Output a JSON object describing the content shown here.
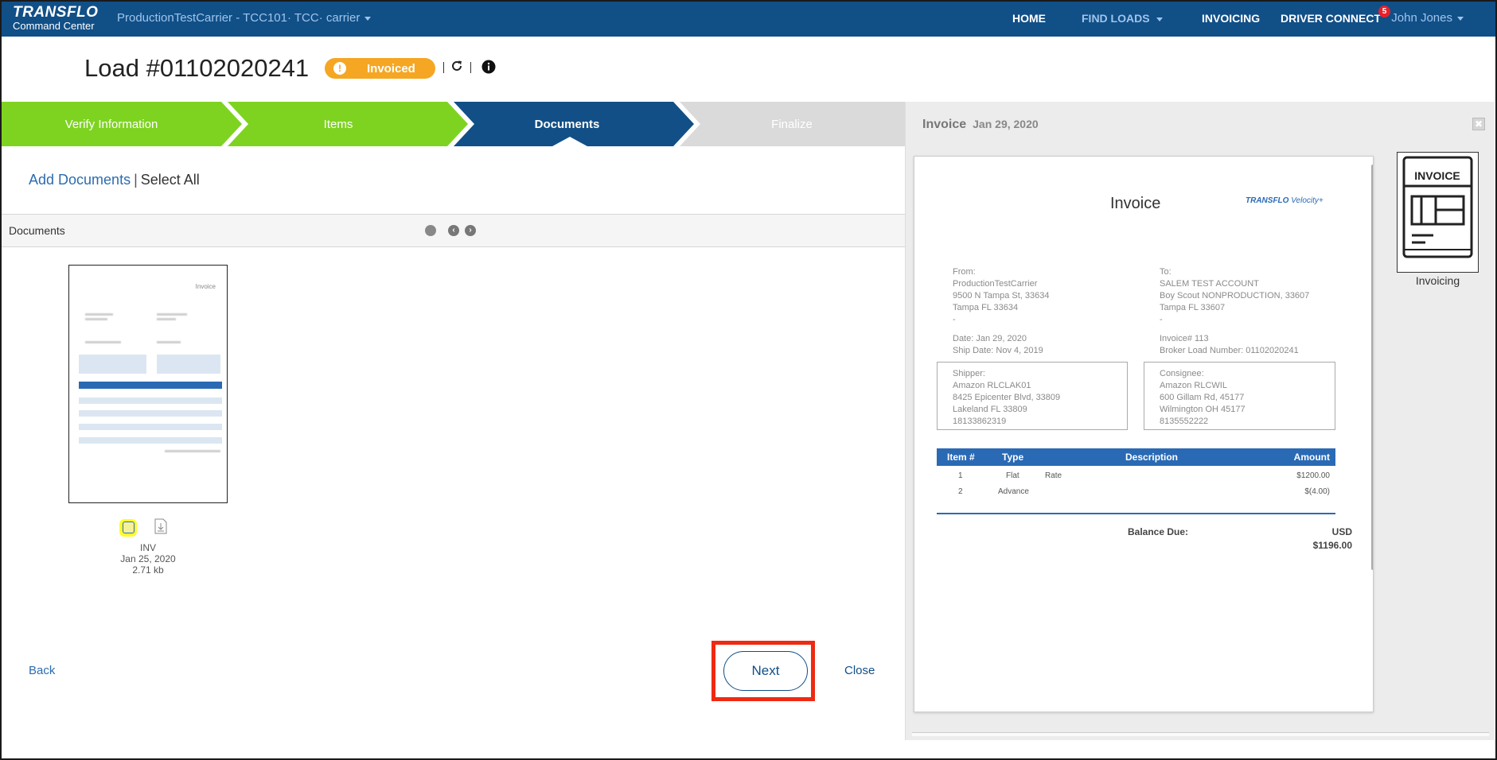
{
  "nav": {
    "brand": "TRANSFLO",
    "brand_sub": "Command Center",
    "carrier": "ProductionTestCarrier - TCC101· TCC· carrier",
    "home": "HOME",
    "find_loads": "FIND LOADS",
    "invoicing": "INVOICING",
    "driver_connect": "DRIVER CONNECT",
    "driver_connect_badge": "5",
    "user": "John Jones"
  },
  "header": {
    "title": "Load #01102020241",
    "status": "Invoiced",
    "status_color": "#f5a623"
  },
  "steps": [
    {
      "label": "Verify Information",
      "state": "complete"
    },
    {
      "label": "Items",
      "state": "complete"
    },
    {
      "label": "Documents",
      "state": "active"
    },
    {
      "label": "Finalize",
      "state": "pending"
    }
  ],
  "documents": {
    "add_label": "Add Documents",
    "separator": "|",
    "select_all_label": "Select All",
    "bar_label": "Documents",
    "thumb_title": "Invoice",
    "doc": {
      "type": "INV",
      "date": "Jan 25, 2020",
      "size": "2.71 kb"
    }
  },
  "footer": {
    "back": "Back",
    "next": "Next",
    "close": "Close"
  },
  "preview": {
    "panel_title": "Invoice",
    "panel_date": "Jan 29, 2020",
    "close_icon": "✖",
    "doc_title": "Invoice",
    "logo": "TRANSFLO",
    "logo_suffix": "Velocity+",
    "from": {
      "label": "From:",
      "line1": "ProductionTestCarrier",
      "line2": "9500 N Tampa St, 33634",
      "line3": "Tampa FL 33634",
      "line4": "-"
    },
    "to": {
      "label": "To:",
      "line1": "SALEM TEST ACCOUNT",
      "line2": "Boy Scout NONPRODUCTION, 33607",
      "line3": "Tampa FL 33607",
      "line4": "-"
    },
    "date_line": "Date: Jan 29, 2020",
    "ship_date_line": "Ship Date: Nov 4, 2019",
    "invoice_line": "Invoice# 113",
    "broker_line": "Broker Load Number: 01102020241",
    "shipper": {
      "label": "Shipper:",
      "line1": "Amazon RLCLAK01",
      "line2": "8425 Epicenter Blvd, 33809",
      "line3": "Lakeland FL 33809",
      "line4": "18133862319"
    },
    "consignee": {
      "label": "Consignee:",
      "line1": "Amazon RLCWIL",
      "line2": "600 Gillam Rd, 45177",
      "line3": "Wilmington OH 45177",
      "line4": "8135552222"
    },
    "table_headers": {
      "item": "Item #",
      "type": "Type",
      "description": "Description",
      "amount": "Amount"
    },
    "rows": [
      {
        "item": "1",
        "type": "Flat",
        "description": "Rate",
        "amount": "$1200.00"
      },
      {
        "item": "2",
        "type": "Advance",
        "description": "",
        "amount": "$(4.00)"
      }
    ],
    "balance_label": "Balance Due:",
    "currency": "USD",
    "balance": "$1196.00",
    "side_card_label": "Invoicing",
    "side_card_icon_text": "INVOICE"
  }
}
